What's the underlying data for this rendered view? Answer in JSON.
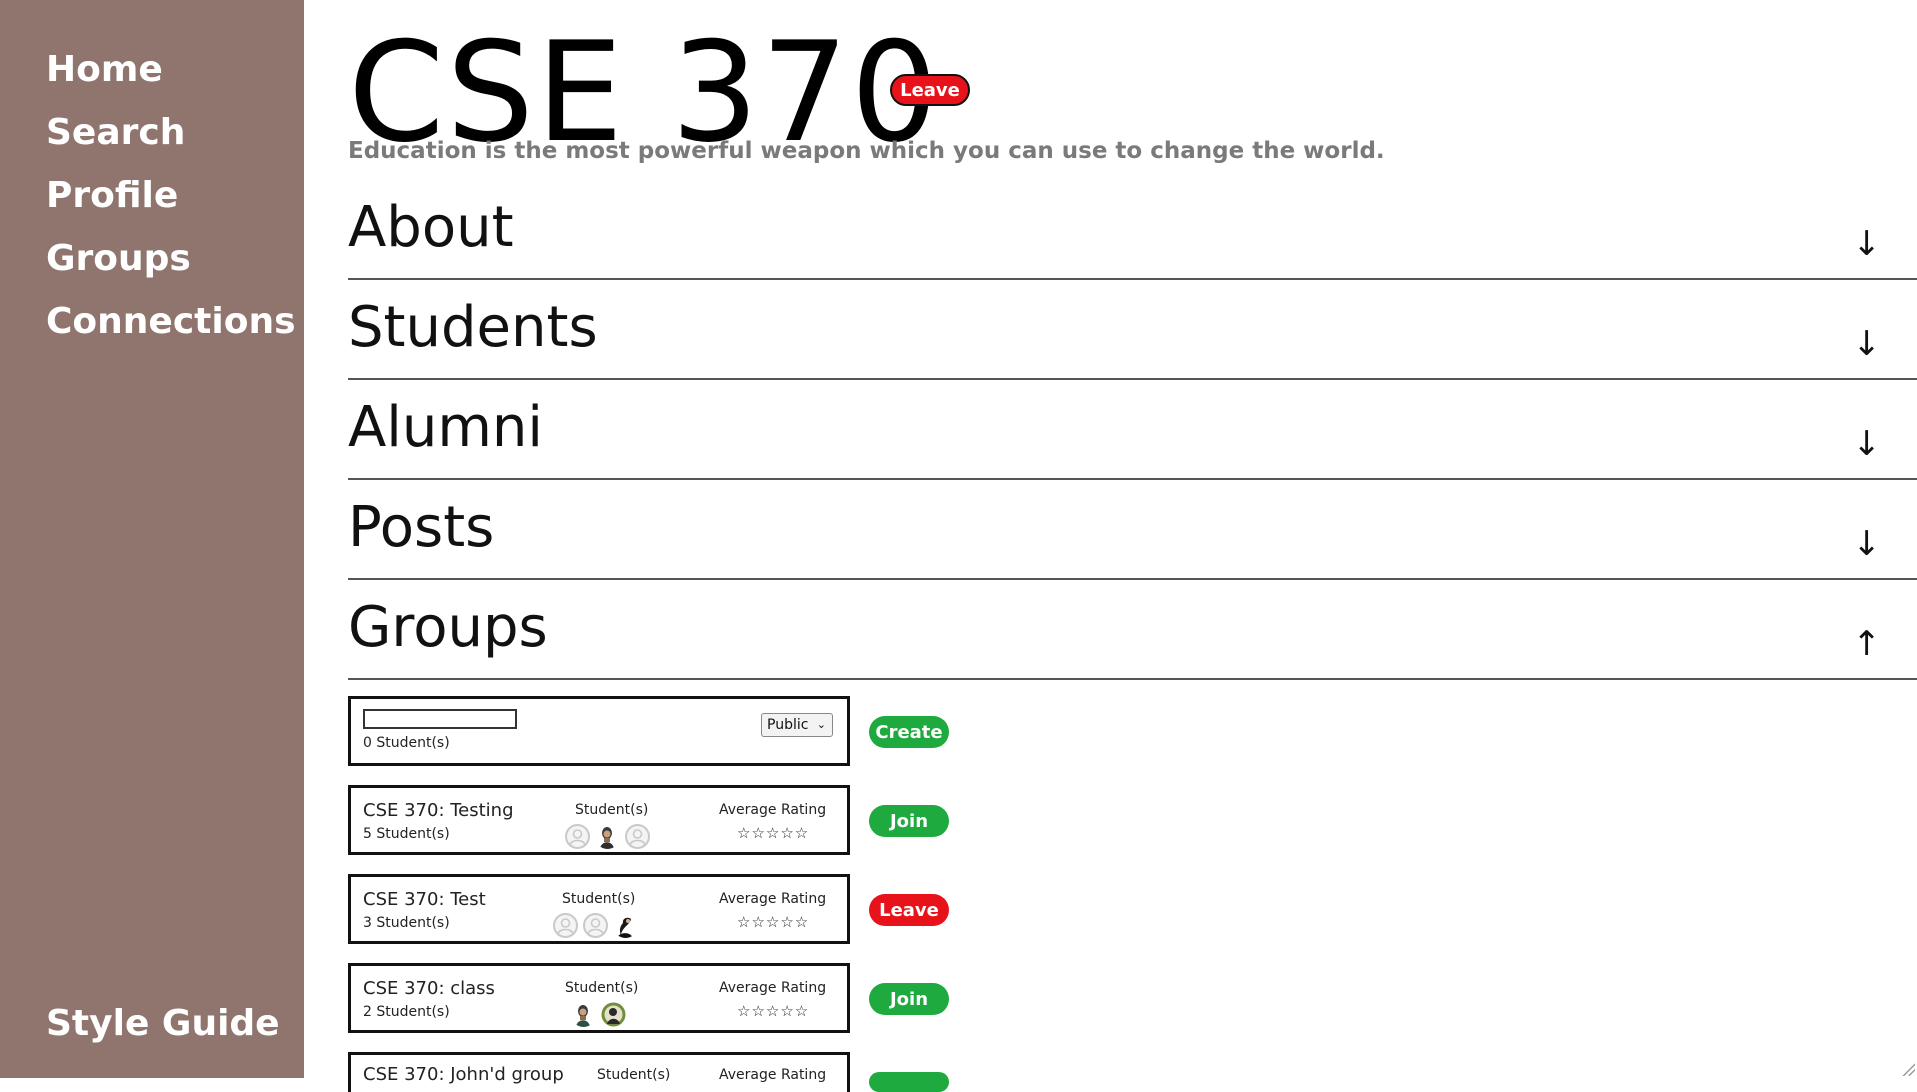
{
  "sidebar": {
    "items": [
      {
        "label": "Home"
      },
      {
        "label": "Search"
      },
      {
        "label": "Profile"
      },
      {
        "label": "Groups"
      },
      {
        "label": "Connections"
      }
    ],
    "bottom_items": [
      {
        "label": "Style Guide"
      }
    ]
  },
  "header": {
    "title": "CSE 370",
    "leave_label": "Leave",
    "quote": "Education is the most powerful weapon which you can use to change the world."
  },
  "sections": [
    {
      "title": "About",
      "arrow": "↓"
    },
    {
      "title": "Students",
      "arrow": "↓"
    },
    {
      "title": "Alumni",
      "arrow": "↓"
    },
    {
      "title": "Posts",
      "arrow": "↓"
    },
    {
      "title": "Groups",
      "arrow": "↑"
    }
  ],
  "new_group": {
    "name_value": "",
    "count": "0 Student(s)",
    "visibility": "Public",
    "action_label": "Create"
  },
  "groups": [
    {
      "name": "CSE 370: Testing",
      "count": "5 Student(s)",
      "students_label": "Student(s)",
      "rating_label": "Average Rating",
      "stars": "☆☆☆☆☆",
      "avatars": [
        "default-avatar",
        "photo-avatar",
        "default-avatar"
      ],
      "action_label": "Join",
      "action_color": "#1faa3f"
    },
    {
      "name": "CSE 370: Test",
      "count": "3 Student(s)",
      "students_label": "Student(s)",
      "rating_label": "Average Rating",
      "stars": "☆☆☆☆☆",
      "avatars": [
        "default-avatar",
        "default-avatar",
        "photo-avatar"
      ],
      "action_label": "Leave",
      "action_color": "#e8131a"
    },
    {
      "name": "CSE 370: class",
      "count": "2 Student(s)",
      "students_label": "Student(s)",
      "rating_label": "Average Rating",
      "stars": "☆☆☆☆☆",
      "avatars": [
        "photo-avatar",
        "photo-avatar"
      ],
      "action_label": "Join",
      "action_color": "#1faa3f"
    },
    {
      "name": "CSE 370: John'd group",
      "students_label": "Student(s)",
      "rating_label": "Average Rating"
    }
  ]
}
